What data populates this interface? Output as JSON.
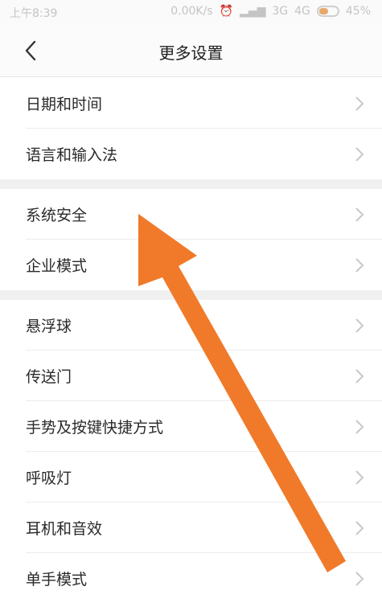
{
  "status_bar": {
    "time": "上午8:39",
    "network_speed": "0.00K/s",
    "signal_3g": "3G",
    "signal_4g": "4G",
    "battery": "45%"
  },
  "header": {
    "title": "更多设置",
    "back_icon": "chevron-left-icon"
  },
  "groups": [
    {
      "items": [
        {
          "label": "日期和时间"
        },
        {
          "label": "语言和输入法"
        }
      ]
    },
    {
      "items": [
        {
          "label": "系统安全"
        },
        {
          "label": "企业模式"
        }
      ]
    },
    {
      "items": [
        {
          "label": "悬浮球"
        },
        {
          "label": "传送门"
        },
        {
          "label": "手势及按键快捷方式"
        },
        {
          "label": "呼吸灯"
        },
        {
          "label": "耳机和音效"
        },
        {
          "label": "单手模式"
        }
      ]
    }
  ],
  "annotation": {
    "color": "#f07a2a",
    "icon": "arrow-icon"
  }
}
